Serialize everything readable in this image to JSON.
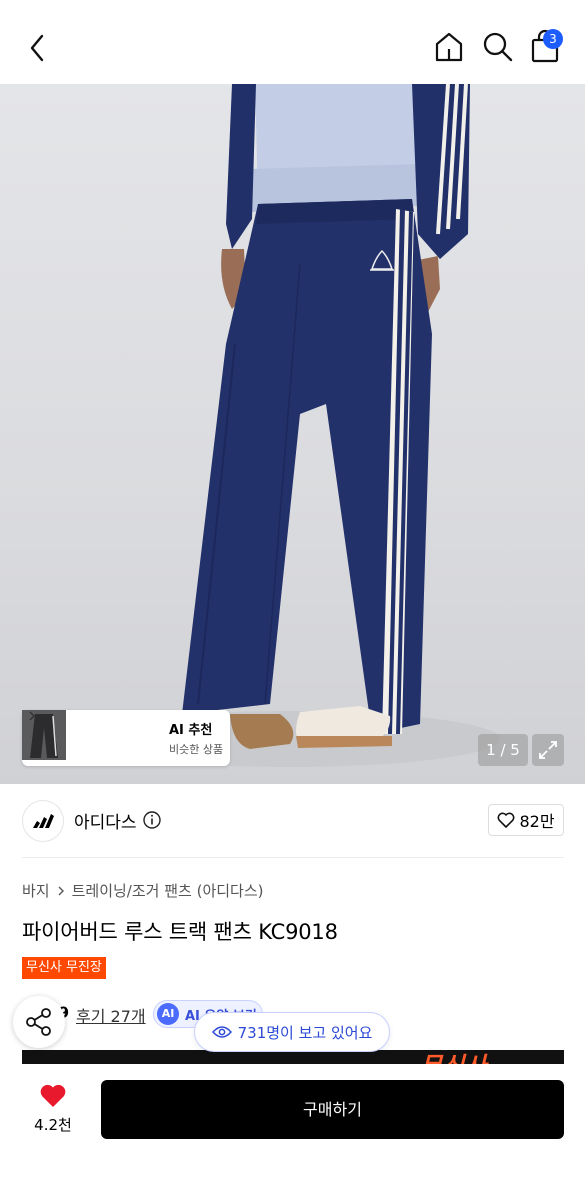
{
  "header": {
    "cart_count": "3",
    "icons": [
      "back-icon",
      "home-icon",
      "search-icon",
      "cart-icon"
    ]
  },
  "gallery": {
    "counter": "1 / 5",
    "ai_card": {
      "title": "AI 추천",
      "subtitle": "비슷한 상품"
    }
  },
  "brand": {
    "name": "아디다스",
    "likes": "82만"
  },
  "product": {
    "breadcrumb": [
      "바지",
      "트레이닝/조거 팬츠 (아디다스)"
    ],
    "title": "파이어버드 루스 트랙 팬츠 KC9018",
    "badge": "무신사 무진장",
    "rating_partial": "9",
    "reviews": "후기 27개",
    "ai_summary": "AI 요약 보기",
    "viewers": "731명이 보고 있어요",
    "banner_text": "무신사"
  },
  "bottom_bar": {
    "fav_count": "4.2천",
    "buy_label": "구매하기"
  },
  "colors": {
    "accent_blue": "#1d5cff",
    "badge_orange": "#ff4800",
    "heart_red": "#e8192c",
    "pants_navy": "#23316b"
  }
}
